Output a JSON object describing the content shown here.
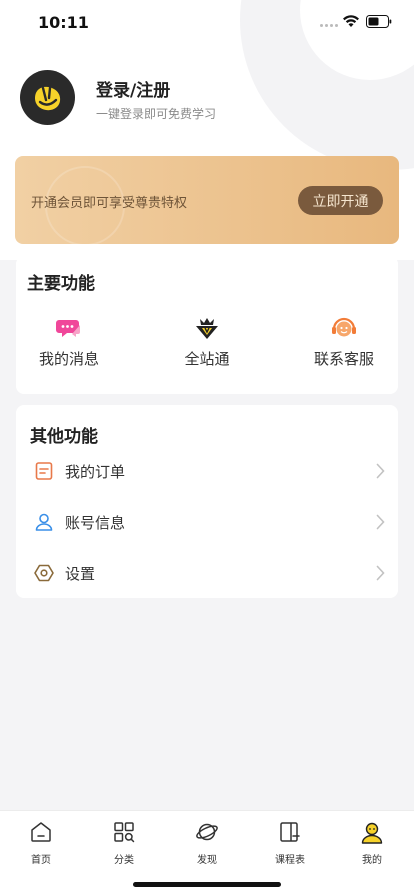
{
  "status_bar": {
    "time": "10:11"
  },
  "profile": {
    "title": "登录/注册",
    "subtitle": "一键登录即可免费学习"
  },
  "vip": {
    "text": "开通会员即可享受尊贵特权",
    "button": "立即开通"
  },
  "main_features": {
    "title": "主要功能",
    "items": [
      {
        "label": "我的消息",
        "icon": "message-icon"
      },
      {
        "label": "全站通",
        "icon": "vip-diamond-icon"
      },
      {
        "label": "联系客服",
        "icon": "customer-service-icon"
      }
    ]
  },
  "other_features": {
    "title": "其他功能",
    "items": [
      {
        "label": "我的订单",
        "icon": "order-icon"
      },
      {
        "label": "账号信息",
        "icon": "account-icon"
      },
      {
        "label": "设置",
        "icon": "settings-icon"
      }
    ]
  },
  "tabbar": {
    "items": [
      {
        "label": "首页",
        "icon": "home-icon"
      },
      {
        "label": "分类",
        "icon": "category-icon"
      },
      {
        "label": "发现",
        "icon": "discover-icon"
      },
      {
        "label": "课程表",
        "icon": "schedule-icon"
      },
      {
        "label": "我的",
        "icon": "mine-icon",
        "active": true
      }
    ]
  },
  "colors": {
    "accent_yellow": "#f6d22a",
    "vip_button": "#7a5a3d",
    "order_icon": "#e8794a",
    "account_icon": "#3a8fe8",
    "settings_icon": "#8a6a3a"
  }
}
